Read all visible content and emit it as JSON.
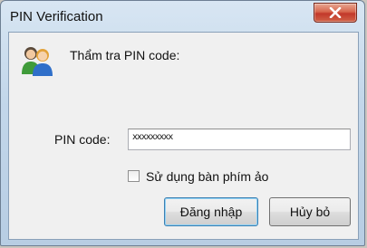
{
  "window": {
    "title": "PIN Verification",
    "close_label": "X"
  },
  "header": {
    "icon": "users-icon",
    "label": "Thẩm tra PIN code:"
  },
  "pin": {
    "label": "PIN code:",
    "value": "xxxxxxxxx"
  },
  "virtual_keyboard": {
    "label": "Sử dụng bàn phím ảo",
    "checked": false
  },
  "buttons": {
    "login_label": "Đăng nhập",
    "cancel_label": "Hủy bỏ"
  },
  "colors": {
    "title_bar": "#c3d7ea",
    "close_button": "#c2382a",
    "client_bg": "#f0f0f0",
    "default_button_border": "#3c7fb1"
  }
}
